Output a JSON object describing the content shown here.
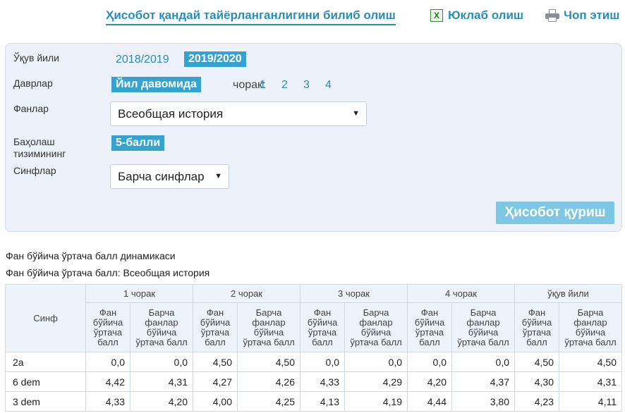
{
  "header": {
    "how_link": "Ҳисобот қандай тайёрланганлигини билиб олиш",
    "download_label": "Юклаб олиш",
    "print_label": "Чоп этиш"
  },
  "filters": {
    "year_label": "Ўқув йили",
    "years": [
      "2018/2019",
      "2019/2020"
    ],
    "year_selected": "2019/2020",
    "period_label": "Даврлар",
    "period_selected": "Йил давомида",
    "quarter_label": "чорак:",
    "quarters": [
      "1",
      "2",
      "3",
      "4"
    ],
    "subject_label": "Фанлар",
    "subject_value": "Всеобщая история",
    "grading_label_line1": "Баҳолаш",
    "grading_label_line2": "тизимининг",
    "grading_value": "5-балли",
    "classes_label": "Синфлар",
    "classes_value": "Барча синфлар",
    "build_button": "Ҳисобот қуриш"
  },
  "report": {
    "title1": "Фан бўйича ўртача балл динамикаси",
    "title2": "Фан бўйича ўртача балл: Всеобщая история",
    "col_class": "Синф",
    "periods": [
      "1 чорак",
      "2 чорак",
      "3 чорак",
      "4 чорак",
      "ўқув йили"
    ],
    "sub_subject": "Фан бўйича ўртача балл",
    "sub_all": "Барча фанлар бўйича ўртача балл",
    "rows": [
      {
        "name": "2a",
        "values": [
          "0,0",
          "0,0",
          "4,50",
          "4,50",
          "0,0",
          "0,0",
          "0,0",
          "0,0",
          "4,50",
          "4,50"
        ]
      },
      {
        "name": "6 dem",
        "values": [
          "4,42",
          "4,31",
          "4,27",
          "4,26",
          "4,33",
          "4,29",
          "4,20",
          "4,37",
          "4,30",
          "4,31"
        ]
      },
      {
        "name": "3 dem",
        "values": [
          "4,33",
          "4,20",
          "4,00",
          "4,25",
          "4,13",
          "4,19",
          "4,44",
          "3,80",
          "4,23",
          "4,11"
        ]
      }
    ]
  }
}
